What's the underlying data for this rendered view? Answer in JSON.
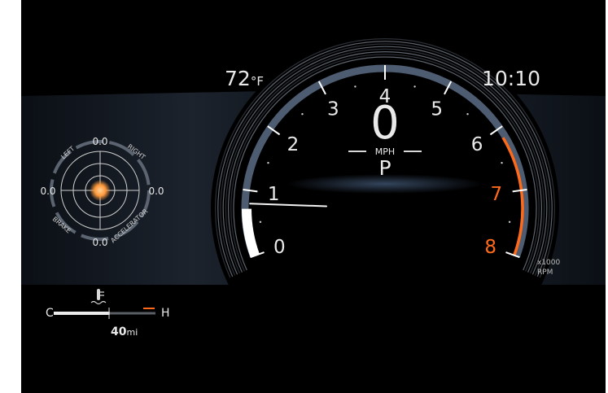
{
  "outside_temperature": {
    "value": "72",
    "unit": "°F"
  },
  "clock": "10:10",
  "speedometer": {
    "speed": "0",
    "unit": "MPH"
  },
  "gear": "P",
  "tachometer": {
    "labels": [
      "0",
      "1",
      "2",
      "3",
      "4",
      "5",
      "6",
      "7",
      "8"
    ],
    "redline_labels": [
      "7",
      "8"
    ],
    "unit_multiplier": "x1000",
    "unit": "RPM",
    "current_rpm": 0.8
  },
  "g_force_meter": {
    "top_value": "0.0",
    "left_value": "0.0",
    "right_value": "0.0",
    "bottom_value": "0.0",
    "left_label": "LEFT",
    "right_label": "RIGHT",
    "brake_label": "BRAKE",
    "accelerator_label": "ACCELERATOR"
  },
  "coolant": {
    "cold_label": "C",
    "hot_label": "H",
    "icon": "coolant-temperature-icon",
    "level": 0.55
  },
  "range": {
    "value": "40",
    "unit": "mi"
  },
  "colors": {
    "background": "#000000",
    "text": "#e9e9e9",
    "redline": "#ff6a1a",
    "gauge_ring": "#4d5c70",
    "gforce_dot": "#ff9a3c"
  }
}
